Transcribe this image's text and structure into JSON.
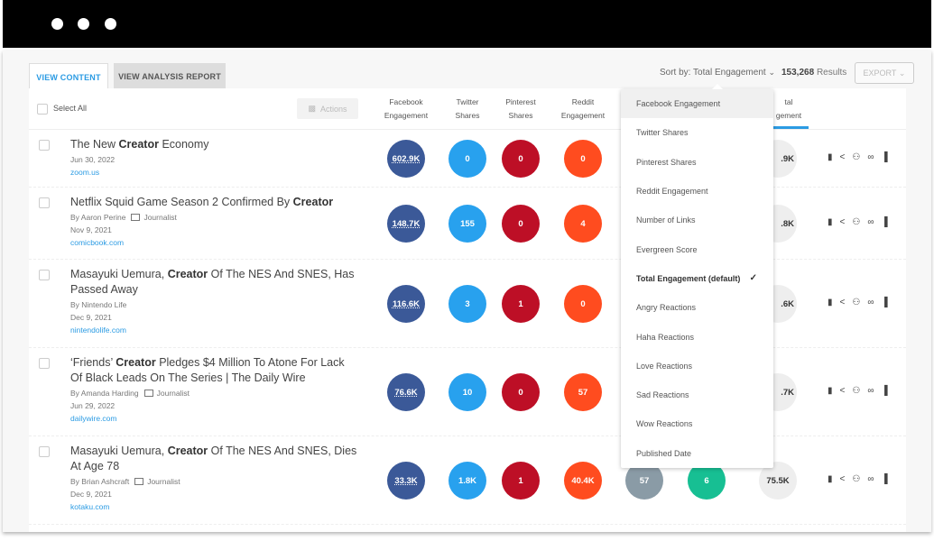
{
  "window": {
    "controls": [
      "close",
      "minimize",
      "maximize"
    ]
  },
  "tabs": [
    {
      "label": "VIEW CONTENT",
      "active": true
    },
    {
      "label": "VIEW ANALYSIS REPORT",
      "active": false
    }
  ],
  "toolbar": {
    "sort_label": "Sort by: Total Engagement",
    "results_count": "153,268",
    "results_label": "Results",
    "export_label": "EXPORT"
  },
  "table": {
    "select_all": "Select All",
    "actions_label": "Actions",
    "columns": [
      {
        "l1": "Facebook",
        "l2": "Engagement"
      },
      {
        "l1": "Twitter",
        "l2": "Shares"
      },
      {
        "l1": "Pinterest",
        "l2": "Shares"
      },
      {
        "l1": "Reddit",
        "l2": "Engagement"
      },
      {
        "l1": "",
        "l2": ""
      },
      {
        "l1": "",
        "l2": ""
      },
      {
        "l1": "tal",
        "l2": "gement"
      }
    ],
    "colors": {
      "facebook": "#3b5998",
      "twitter": "#28a1ee",
      "pinterest": "#bd0f26",
      "reddit": "#ff4c1f",
      "col5": "#8a9ba6",
      "col6": "#17bf93",
      "total": "#eeeeee"
    },
    "rows": [
      {
        "pre": "The New ",
        "bold": "Creator",
        "post": " Economy",
        "author": "",
        "journalist": "",
        "date": "Jun 30, 2022",
        "domain": "zoom.us",
        "fb": "602.9K",
        "tw": "0",
        "pin": "0",
        "rd": "0",
        "c5": "",
        "c6": "",
        "total": ".9K"
      },
      {
        "pre": "Netflix Squid Game Season 2 Confirmed By ",
        "bold": "Creator",
        "post": "",
        "author": "By Aaron Perine",
        "journalist": "Journalist",
        "date": "Nov 9, 2021",
        "domain": "comicbook.com",
        "fb": "148.7K",
        "tw": "155",
        "pin": "0",
        "rd": "4",
        "c5": "",
        "c6": "",
        "total": ".8K"
      },
      {
        "pre": "Masayuki Uemura, ",
        "bold": "Creator",
        "post": " Of The NES And SNES, Has Passed Away",
        "author": "By  Nintendo Life",
        "journalist": "",
        "date": "Dec 9, 2021",
        "domain": "nintendolife.com",
        "fb": "116.6K",
        "tw": "3",
        "pin": "1",
        "rd": "0",
        "c5": "",
        "c6": "",
        "total": ".6K"
      },
      {
        "pre": "‘Friends’ ",
        "bold": "Creator",
        "post": " Pledges $4 Million To Atone For Lack Of Black Leads On The Series | The Daily Wire",
        "author": "By Amanda Harding",
        "journalist": "Journalist",
        "date": "Jun 29, 2022",
        "domain": "dailywire.com",
        "fb": "76.6K",
        "tw": "10",
        "pin": "0",
        "rd": "57",
        "c5": "",
        "c6": "",
        "total": ".7K"
      },
      {
        "pre": "Masayuki Uemura, ",
        "bold": "Creator",
        "post": " Of The NES And SNES, Dies At Age 78",
        "author": "By Brian Ashcraft",
        "journalist": "Journalist",
        "date": "Dec 9, 2021",
        "domain": "kotaku.com",
        "fb": "33.3K",
        "tw": "1.8K",
        "pin": "1",
        "rd": "40.4K",
        "c5": "57",
        "c6": "6",
        "total": "75.5K"
      }
    ],
    "row_icons": [
      "bookmark-icon",
      "share-icon",
      "people-icon",
      "link-icon",
      "bar-chart-icon"
    ]
  },
  "sort_menu": {
    "options": [
      "Facebook Engagement",
      "Twitter Shares",
      "Pinterest Shares",
      "Reddit Engagement",
      "Number of Links",
      "Evergreen Score",
      "Total Engagement (default)",
      "Angry Reactions",
      "Haha Reactions",
      "Love Reactions",
      "Sad Reactions",
      "Wow Reactions",
      "Published Date"
    ],
    "selected": "Total Engagement (default)",
    "hovered": "Facebook Engagement"
  }
}
